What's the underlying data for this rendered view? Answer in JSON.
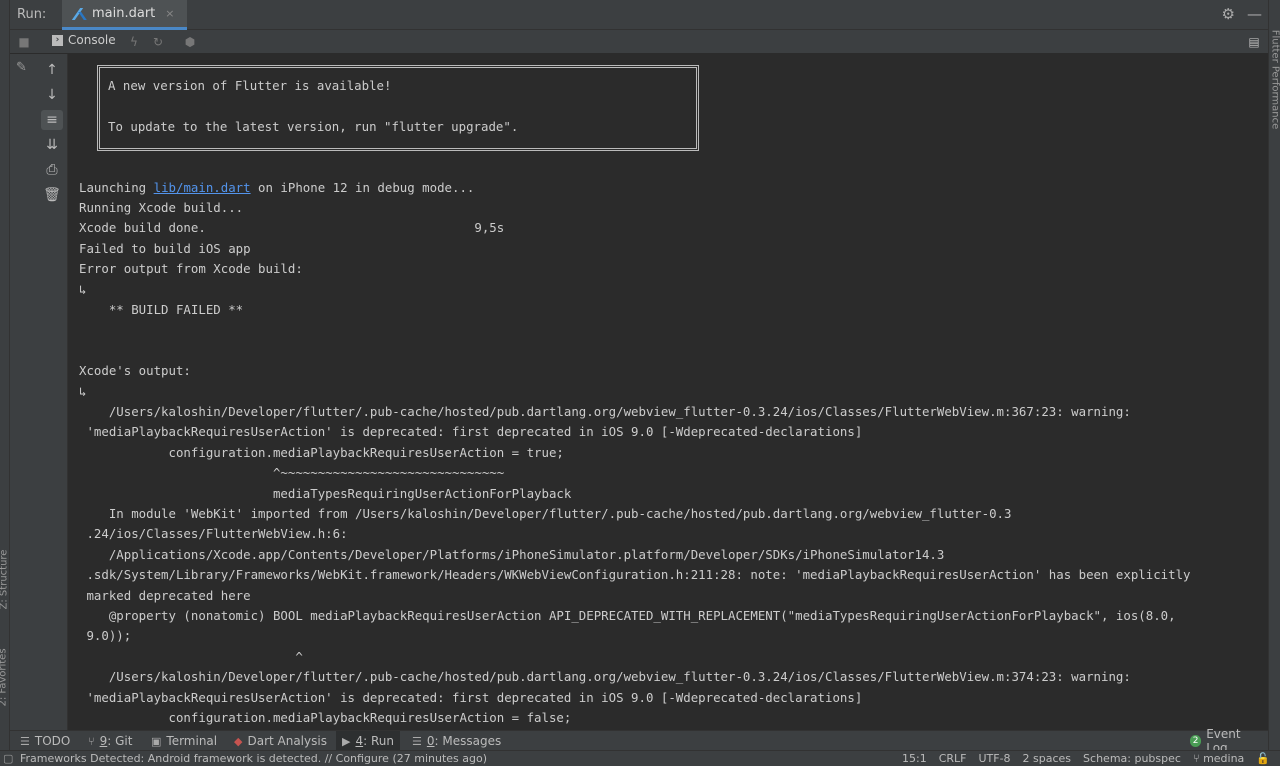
{
  "run_header": {
    "label": "Run:",
    "file_tab": "main.dart",
    "close_glyph": "×",
    "settings_glyph": "⚙",
    "minimize_glyph": "—"
  },
  "edge": {
    "structure": "Z: Structure",
    "favorites": "2: Favorites",
    "flutter_performance": "Flutter Performance"
  },
  "console_toolbar": {
    "console_label": "Console"
  },
  "banner": {
    "line1": "A new version of Flutter is available!",
    "line2": "To update to the latest version, run \"flutter upgrade\"."
  },
  "output": {
    "launching_prefix": "Launching ",
    "launching_link": "lib/main.dart",
    "launching_suffix": " on iPhone 12 in debug mode...",
    "lines": [
      "Running Xcode build...",
      "Xcode build done.                                    9,5s",
      "Failed to build iOS app",
      "Error output from Xcode build:",
      "↳",
      "    ** BUILD FAILED **",
      "",
      "",
      "Xcode's output:",
      "↳",
      "    /Users/kaloshin/Developer/flutter/.pub-cache/hosted/pub.dartlang.org/webview_flutter-0.3.24/ios/Classes/FlutterWebView.m:367:23: warning:",
      " 'mediaPlaybackRequiresUserAction' is deprecated: first deprecated in iOS 9.0 [-Wdeprecated-declarations]",
      "            configuration.mediaPlaybackRequiresUserAction = true;",
      "                          ^~~~~~~~~~~~~~~~~~~~~~~~~~~~~~~",
      "                          mediaTypesRequiringUserActionForPlayback",
      "    In module 'WebKit' imported from /Users/kaloshin/Developer/flutter/.pub-cache/hosted/pub.dartlang.org/webview_flutter-0.3",
      " .24/ios/Classes/FlutterWebView.h:6:",
      "    /Applications/Xcode.app/Contents/Developer/Platforms/iPhoneSimulator.platform/Developer/SDKs/iPhoneSimulator14.3",
      " .sdk/System/Library/Frameworks/WebKit.framework/Headers/WKWebViewConfiguration.h:211:28: note: 'mediaPlaybackRequiresUserAction' has been explicitly",
      " marked deprecated here",
      "    @property (nonatomic) BOOL mediaPlaybackRequiresUserAction API_DEPRECATED_WITH_REPLACEMENT(\"mediaTypesRequiringUserActionForPlayback\", ios(8.0,",
      " 9.0));",
      "                             ^",
      "    /Users/kaloshin/Developer/flutter/.pub-cache/hosted/pub.dartlang.org/webview_flutter-0.3.24/ios/Classes/FlutterWebView.m:374:23: warning:",
      " 'mediaPlaybackRequiresUserAction' is deprecated: first deprecated in iOS 9.0 [-Wdeprecated-declarations]",
      "            configuration.mediaPlaybackRequiresUserAction = false;"
    ]
  },
  "bottom_tabs": {
    "todo": "TODO",
    "git_num": "9",
    "git": ": Git",
    "terminal": "Terminal",
    "dart_analysis": "Dart Analysis",
    "run_num": "4",
    "run": ": Run",
    "messages_num": "0",
    "messages": ": Messages",
    "event_log_badge": "2",
    "event_log": "Event Log"
  },
  "status": {
    "message": "Frameworks Detected: Android framework is detected. // Configure (27 minutes ago)",
    "position": "15:1",
    "line_sep": "CRLF",
    "encoding": "UTF-8",
    "indent": "2 spaces",
    "schema": "Schema: pubspec",
    "branch": "medina"
  },
  "colors": {
    "link": "#5394ec",
    "background": "#2b2b2b",
    "panel": "#3c3f41"
  }
}
